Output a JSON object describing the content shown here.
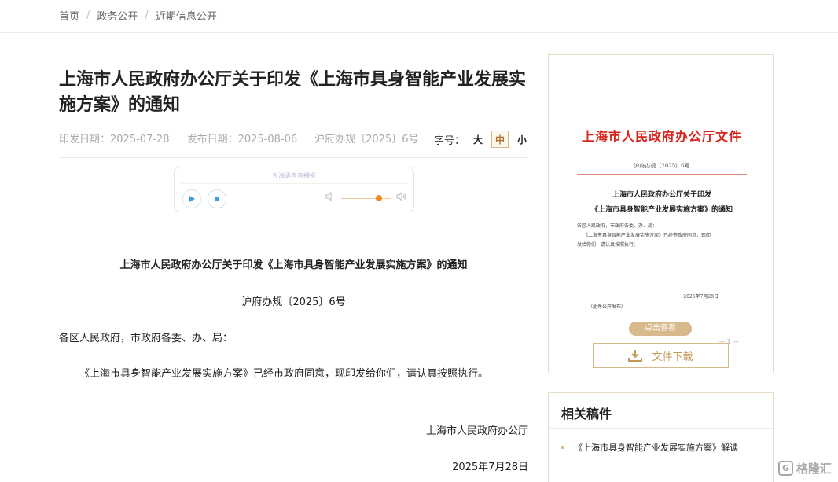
{
  "breadcrumb": [
    "首页",
    "政务公开",
    "近期信息公开"
  ],
  "article": {
    "title": "上海市人民政府办公厅关于印发《上海市具身智能产业发展实施方案》的通知",
    "issue_date": "印发日期：2025-07-28",
    "publish_date": "发布日期：2025-08-06",
    "doc_number": "沪府办规〔2025〕6号"
  },
  "font_size": {
    "label": "字号：",
    "options": [
      "大",
      "中",
      "小"
    ],
    "selected": "中"
  },
  "audio": {
    "label": "大海语言音播报",
    "volume": 0.75
  },
  "body": {
    "heading": "上海市人民政府办公厅关于印发《上海市具身智能产业发展实施方案》的通知",
    "number": "沪府办规〔2025〕6号",
    "salutation": "各区人民政府，市政府各委、办、局：",
    "paragraph": "《上海市具身智能产业发展实施方案》已经市政府同意，现印发给你们，请认真按照执行。",
    "signature": "上海市人民政府办公厅",
    "date": "2025年7月28日"
  },
  "file_preview": {
    "header": "上海市人民政府办公厅文件",
    "number": "沪府办规〔2025〕6号",
    "title_line1": "上海市人民政府办公厅关于印发",
    "title_line2": "《上海市具身智能产业发展实施方案》的通知",
    "text_line1": "各区人民政府，市政府各委、办、局：",
    "text_line2": "《上海市具身智能产业发展实施方案》已经市政府同意，现印",
    "text_line3": "发给你们，请认真按照执行。",
    "date": "2025年7月28日",
    "public_note": "（此件公开发布）",
    "view_label": "点击查看",
    "page_indicator": "— 1 —",
    "download_label": "文件下载"
  },
  "related": {
    "title": "相关稿件",
    "items": [
      "《上海市具身智能产业发展实施方案》解读"
    ]
  },
  "watermark": {
    "logo": "G",
    "text": "格隆汇"
  },
  "colors": {
    "accent_gold": "#d7b98b",
    "accent_orange": "#f08a24",
    "red_header": "#d7241c"
  }
}
